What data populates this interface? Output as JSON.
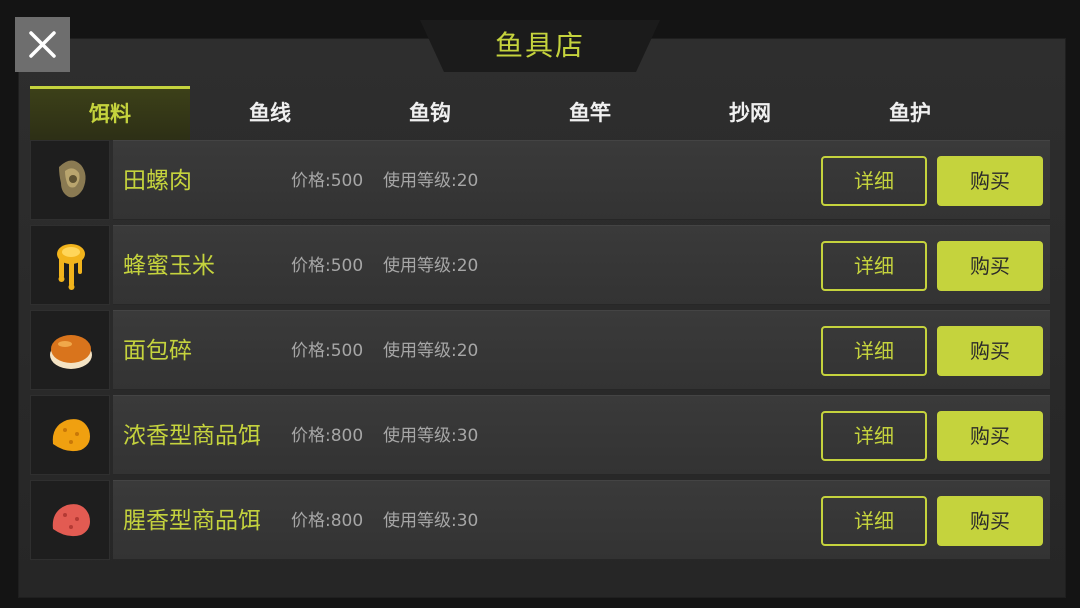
{
  "header": {
    "title": "鱼具店",
    "close_icon": "close-icon"
  },
  "tabs": [
    {
      "label": "饵料",
      "active": true
    },
    {
      "label": "鱼线",
      "active": false
    },
    {
      "label": "鱼钩",
      "active": false
    },
    {
      "label": "鱼竿",
      "active": false
    },
    {
      "label": "抄网",
      "active": false
    },
    {
      "label": "鱼护",
      "active": false
    }
  ],
  "items": [
    {
      "name": "",
      "price": "",
      "level": "",
      "icon": "green-bait-icon",
      "detail_label": "",
      "buy_label": ""
    },
    {
      "name": "田螺肉",
      "price": "价格:500",
      "level": "使用等级:20",
      "icon": "snail-meat-icon",
      "detail_label": "详细",
      "buy_label": "购买"
    },
    {
      "name": "蜂蜜玉米",
      "price": "价格:500",
      "level": "使用等级:20",
      "icon": "honey-corn-icon",
      "detail_label": "详细",
      "buy_label": "购买"
    },
    {
      "name": "面包碎",
      "price": "价格:500",
      "level": "使用等级:20",
      "icon": "bread-crumbs-icon",
      "detail_label": "详细",
      "buy_label": "购买"
    },
    {
      "name": "浓香型商品饵",
      "price": "价格:800",
      "level": "使用等级:30",
      "icon": "strong-scent-bait-icon",
      "detail_label": "详细",
      "buy_label": "购买"
    },
    {
      "name": "腥香型商品饵",
      "price": "价格:800",
      "level": "使用等级:30",
      "icon": "fishy-scent-bait-icon",
      "detail_label": "详细",
      "buy_label": "购买"
    }
  ],
  "colors": {
    "accent": "#c5d33d",
    "panel": "#2b2b2b",
    "row": "#363636",
    "muted_text": "#a6a6a6"
  }
}
